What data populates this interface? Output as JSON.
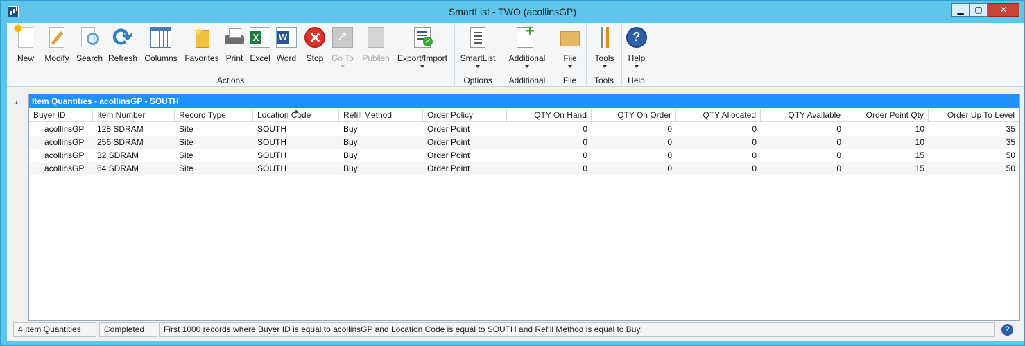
{
  "window": {
    "title": "SmartList  -  TWO (acollinsGP)",
    "min_glyph": "▁",
    "max_glyph": "▢",
    "close_glyph": "✕"
  },
  "ribbon": {
    "groups": {
      "actions": "Actions",
      "options": "Options",
      "additional": "Additional",
      "file": "File",
      "tools": "Tools",
      "help": "Help"
    },
    "buttons": {
      "new": "New",
      "modify": "Modify",
      "search": "Search",
      "refresh": "Refresh",
      "columns": "Columns",
      "favorites": "Favorites",
      "print": "Print",
      "excel": "Excel",
      "word": "Word",
      "stop": "Stop",
      "goto": "Go To",
      "publish": "Publish",
      "export_import": "Export/Import",
      "smartlist": "SmartList",
      "additional": "Additional",
      "file": "File",
      "tools": "Tools",
      "help": "Help"
    }
  },
  "grid": {
    "expander": "›",
    "title": "Item Quantities - acollinsGP - SOUTH",
    "columns": [
      "Buyer ID",
      "Item Number",
      "Record Type",
      "Location Code",
      "Refill Method",
      "Order Policy",
      "QTY On Hand",
      "QTY On Order",
      "QTY Allocated",
      "QTY Available",
      "Order Point Qty",
      "Order Up To Level"
    ],
    "rows": [
      [
        "acollinsGP",
        "128 SDRAM",
        "Site",
        "SOUTH",
        "Buy",
        "Order Point",
        "0",
        "0",
        "0",
        "0",
        "10",
        "35"
      ],
      [
        "acollinsGP",
        "256 SDRAM",
        "Site",
        "SOUTH",
        "Buy",
        "Order Point",
        "0",
        "0",
        "0",
        "0",
        "10",
        "35"
      ],
      [
        "acollinsGP",
        "32 SDRAM",
        "Site",
        "SOUTH",
        "Buy",
        "Order Point",
        "0",
        "0",
        "0",
        "0",
        "15",
        "50"
      ],
      [
        "acollinsGP",
        "64 SDRAM",
        "Site",
        "SOUTH",
        "Buy",
        "Order Point",
        "0",
        "0",
        "0",
        "0",
        "15",
        "50"
      ]
    ]
  },
  "status": {
    "count": "4 Item Quantities",
    "state": "Completed",
    "criteria": "First 1000 records where Buyer ID is equal to acollinsGP and Location Code is equal to SOUTH and Refill Method is equal to Buy.",
    "help_glyph": "?"
  },
  "colors": {
    "frame": "#5ec6ea",
    "grid_title_bg": "#1e90ff",
    "close_button": "#c94337"
  }
}
